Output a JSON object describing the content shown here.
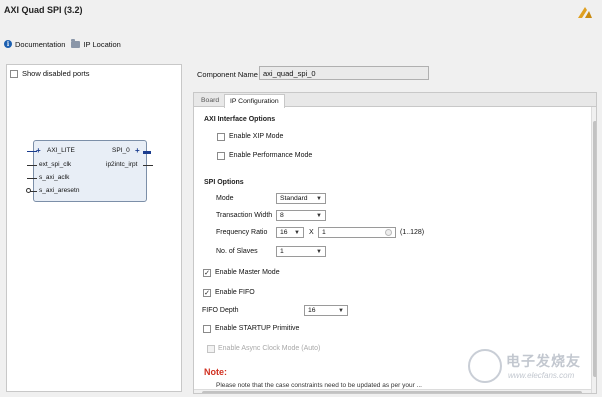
{
  "window": {
    "title": "AXI Quad SPI (3.2)"
  },
  "toolbar": {
    "documentation": "Documentation",
    "ip_location": "IP Location"
  },
  "left_panel": {
    "show_disabled_ports": "Show disabled ports",
    "block": {
      "left_pins": [
        "AXI_LITE",
        "ext_spi_clk",
        "s_axi_aclk",
        "s_axi_aresetn"
      ],
      "right_pins": [
        "SPI_0",
        "ip2intc_irpt"
      ]
    }
  },
  "component": {
    "label": "Component Name",
    "value": "axi_quad_spi_0"
  },
  "tabs": [
    "Board",
    "IP Configuration"
  ],
  "axi_interface": {
    "title": "AXI Interface Options",
    "enable_xip": "Enable XIP Mode",
    "enable_perf": "Enable Performance Mode"
  },
  "spi_options": {
    "title": "SPI Options",
    "mode_label": "Mode",
    "mode_value": "Standard",
    "tw_label": "Transaction Width",
    "tw_value": "8",
    "fr_label": "Frequency Ratio",
    "fr_value": "16",
    "fr_x": "X",
    "fr_mult": "1",
    "fr_range": "(1..128)",
    "slaves_label": "No. of Slaves",
    "slaves_value": "1"
  },
  "options": {
    "master_mode": "Enable Master Mode",
    "master_checked": true,
    "fifo": "Enable FIFO",
    "fifo_checked": true,
    "fifo_depth_label": "FIFO Depth",
    "fifo_depth_value": "16",
    "startup": "Enable STARTUP Primitive",
    "startup_checked": false,
    "async": "Enable Async Clock Mode (Auto)"
  },
  "note": {
    "title": "Note:",
    "text": "Please note that the case constraints need to be updated as per your ..."
  },
  "watermark": {
    "title": "电子发烧友",
    "url": "www.elecfans.com"
  },
  "colors": {
    "note": "#d03020",
    "block_fill": "#e8eef6",
    "logo": "#e0a020"
  }
}
